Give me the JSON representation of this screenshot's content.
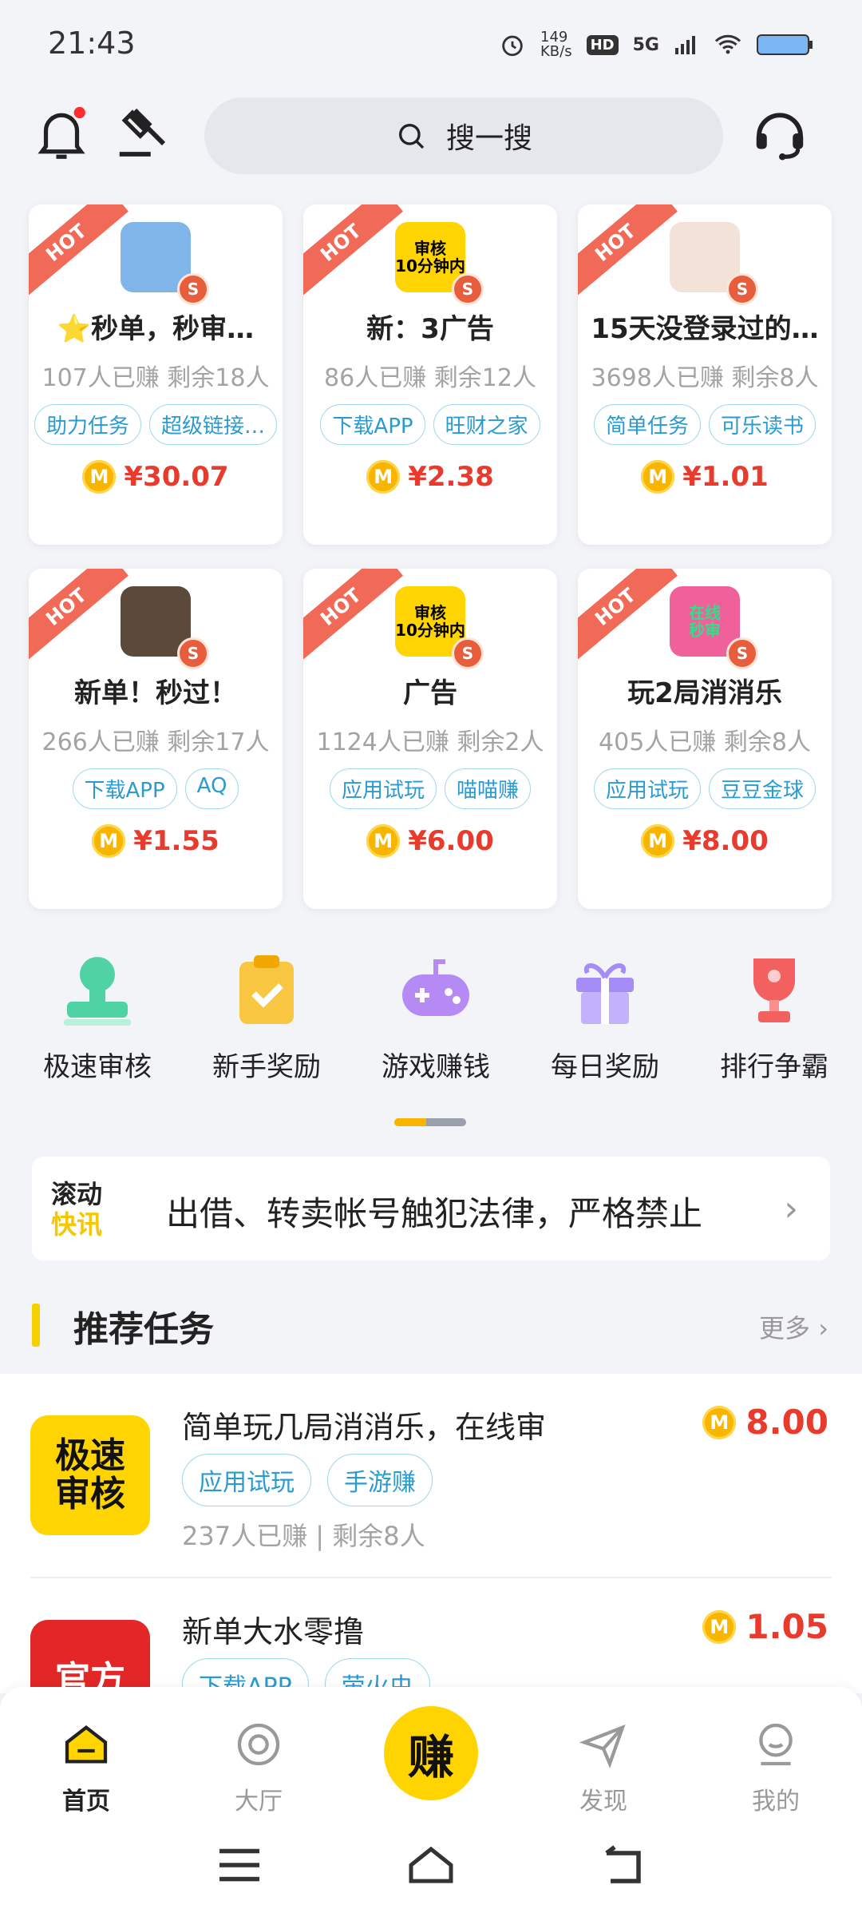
{
  "status_bar": {
    "time": "21:43",
    "net_speed": "149",
    "net_unit": "KB/s",
    "hd": "HD",
    "network": "5G"
  },
  "header": {
    "search_placeholder": "搜一搜",
    "icons": [
      "bell-icon",
      "gavel-icon",
      "search-icon",
      "headset-icon"
    ],
    "notification_dot_color": "#ff2d2d"
  },
  "hot_cards": [
    {
      "badge": "HOT",
      "title": "⭐秒单，秒审…",
      "stats": "107人已赚  剩余18人",
      "tags": [
        "助力任务",
        "超级链接…"
      ],
      "price": "¥30.07",
      "thumb_text": "",
      "thumb_color": "#7fb5e8"
    },
    {
      "badge": "HOT",
      "title": "新：3广告",
      "stats": "86人已赚  剩余12人",
      "tags": [
        "下载APP",
        "旺财之家"
      ],
      "price": "¥2.38",
      "thumb_text": "审核\n10分钟内",
      "thumb_color": "#ffd400"
    },
    {
      "badge": "HOT",
      "title": "15天没登录过的…",
      "stats": "3698人已赚  剩余8人",
      "tags": [
        "简单任务",
        "可乐读书"
      ],
      "price": "¥1.01",
      "thumb_text": "",
      "thumb_color": "#f2e2d8"
    },
    {
      "badge": "HOT",
      "title": "新单！秒过！",
      "stats": "266人已赚  剩余17人",
      "tags": [
        "下载APP",
        "AQ"
      ],
      "price": "¥1.55",
      "thumb_text": "",
      "thumb_color": "#5b4a3a"
    },
    {
      "badge": "HOT",
      "title": "广告",
      "stats": "1124人已赚  剩余2人",
      "tags": [
        "应用试玩",
        "喵喵赚"
      ],
      "price": "¥6.00",
      "thumb_text": "审核\n10分钟内",
      "thumb_color": "#ffd400"
    },
    {
      "badge": "HOT",
      "title": "玩2局消消乐",
      "stats": "405人已赚  剩余8人",
      "tags": [
        "应用试玩",
        "豆豆金球"
      ],
      "price": "¥8.00",
      "thumb_text": "在线\n秒审",
      "thumb_color": "#f0609a"
    }
  ],
  "quick_menu": [
    {
      "label": "极速审核",
      "icon": "stamp-icon",
      "color": "#4fd3a4"
    },
    {
      "label": "新手奖励",
      "icon": "clipboard-check-icon",
      "color": "#f8c640"
    },
    {
      "label": "游戏赚钱",
      "icon": "gamepad-icon",
      "color": "#b58af5"
    },
    {
      "label": "每日奖励",
      "icon": "gift-icon",
      "color": "#a58cf6"
    },
    {
      "label": "排行争霸",
      "icon": "trophy-icon",
      "color": "#f26060"
    }
  ],
  "news": {
    "tag_line1": "滚动",
    "tag_line2": "快讯",
    "text": "出借、转卖帐号触犯法律，严格禁止"
  },
  "recommended": {
    "title": "推荐任务",
    "more": "更多",
    "tasks": [
      {
        "thumb_text": "极速\n审核",
        "thumb_bg": "#ffd400",
        "title": "简单玩几局消消乐，在线审",
        "tags": [
          "应用试玩",
          "手游赚"
        ],
        "stats": "237人已赚  |  剩余8人",
        "price": "8.00"
      },
      {
        "thumb_text": "官方",
        "thumb_bg": "#e32626",
        "title": "新单大水零撸",
        "tags": [
          "下载APP",
          "萤火虫"
        ],
        "stats": "",
        "price": "1.05"
      }
    ]
  },
  "bottom_nav": {
    "items": [
      {
        "label": "首页",
        "icon": "home-icon",
        "active": true
      },
      {
        "label": "大厅",
        "icon": "hall-icon",
        "active": false
      },
      {
        "label": "赚",
        "icon": "earn-icon",
        "active": false
      },
      {
        "label": "发现",
        "icon": "paper-plane-icon",
        "active": false
      },
      {
        "label": "我的",
        "icon": "profile-icon",
        "active": false
      }
    ]
  },
  "coin_glyph": "M"
}
